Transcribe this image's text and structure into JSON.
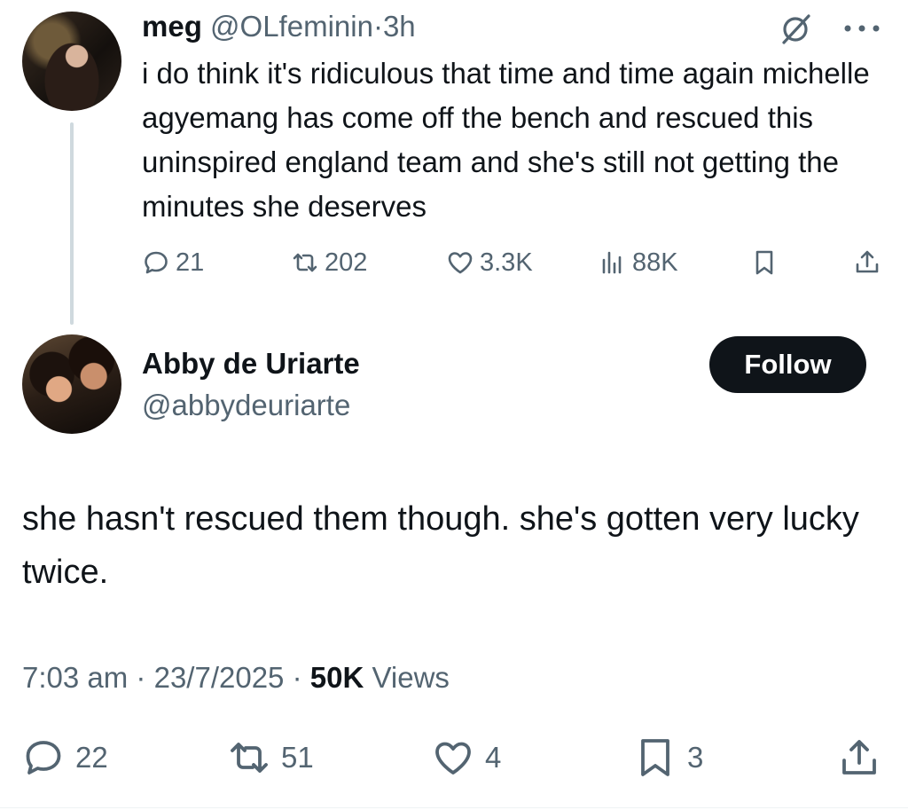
{
  "tweet1": {
    "display_name": "meg",
    "handle": "@OLfeminin",
    "separator": "·",
    "time": "3h",
    "text": "i do think it's ridiculous that time and time again michelle agyemang has come off the bench and rescued this uninspired england team and she's still not getting the minutes she deserves",
    "stats": {
      "replies": "21",
      "reposts": "202",
      "likes": "3.3K",
      "views": "88K"
    }
  },
  "tweet2": {
    "display_name": "Abby de Uriarte",
    "handle": "@abbydeuriarte",
    "follow_label": "Follow",
    "text": "she hasn't rescued them though. she's gotten very lucky twice.",
    "time": "7:03 am",
    "date": "23/7/2025",
    "views_count": "50K",
    "views_label": "Views",
    "separator": "·",
    "stats": {
      "replies": "22",
      "reposts": "51",
      "likes": "4",
      "bookmarks": "3"
    }
  },
  "icons": {
    "reply": "speech-bubble-icon",
    "repost": "repost-arrows-icon",
    "like": "heart-icon",
    "views": "bar-chart-icon",
    "bookmark": "bookmark-icon",
    "share": "share-upload-icon",
    "grok": "grok-slash-icon",
    "more": "more-dots-icon"
  },
  "colors": {
    "text": "#0f1419",
    "secondary": "#536471",
    "thread_line": "#cfd9de",
    "button_bg": "#0f1419",
    "button_text": "#ffffff"
  }
}
